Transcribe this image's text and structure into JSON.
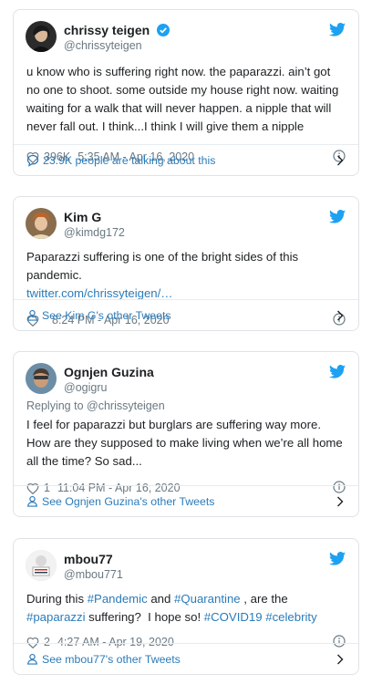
{
  "tweets": [
    {
      "name": "chrissy teigen",
      "handle": "@chrissyteigen",
      "verified": true,
      "reply_to": "",
      "text": "u know who is suffering right now. the paparazzi. ain’t got no one to shoot. some outside my house right now. waiting waiting for a walk that will never happen. a nipple that will never fall out. I think...I think I will give them a nipple",
      "likes": "396K",
      "time": "5:35 AM - Apr 16, 2020",
      "footer": "23.9K people are talking about this",
      "footer_icon": "speech-bubble-icon"
    },
    {
      "name": "Kim G",
      "handle": "@kimdg172",
      "verified": false,
      "reply_to": "",
      "text": "Paparazzi suffering is one of the bright sides of this pandemic.",
      "link": "twitter.com/chrissyteigen/…",
      "likes": "",
      "time": "8:24 PM - Apr 16, 2020",
      "footer": "See Kim G's other Tweets",
      "footer_icon": "person-icon"
    },
    {
      "name": "Ognjen Guzina",
      "handle": "@ogigru",
      "verified": false,
      "reply_to": "Replying to @chrissyteigen",
      "text": "I feel for paparazzi but burglars are suffering way more. How are they supposed to make living when we’re all home all the time? So sad...",
      "likes": "1",
      "time": "11:04 PM - Apr 16, 2020",
      "footer": "See Ognjen Guzina's other Tweets",
      "footer_icon": "person-icon"
    },
    {
      "name": "mbou77",
      "handle": "@mbou771",
      "verified": false,
      "reply_to": "",
      "text_parts": {
        "p1": "During this ",
        "t1": "#Pandemic",
        "p2": " and ",
        "t2": "#Quarantine",
        "p3": " , are the ",
        "t3": "#paparazzi",
        "p4": " suffering?  I hope so! ",
        "t4": "#COVID19",
        "p5": " ",
        "t5": "#celebrity"
      },
      "likes": "2",
      "time": "4:27 AM - Apr 19, 2020",
      "footer": "See mbou77's other Tweets",
      "footer_icon": "person-icon"
    }
  ],
  "colors": {
    "twitter_blue": "#1da1f2",
    "link_blue": "#2b7bb9",
    "meta_gray": "#697882",
    "border": "#dfe3e6"
  }
}
